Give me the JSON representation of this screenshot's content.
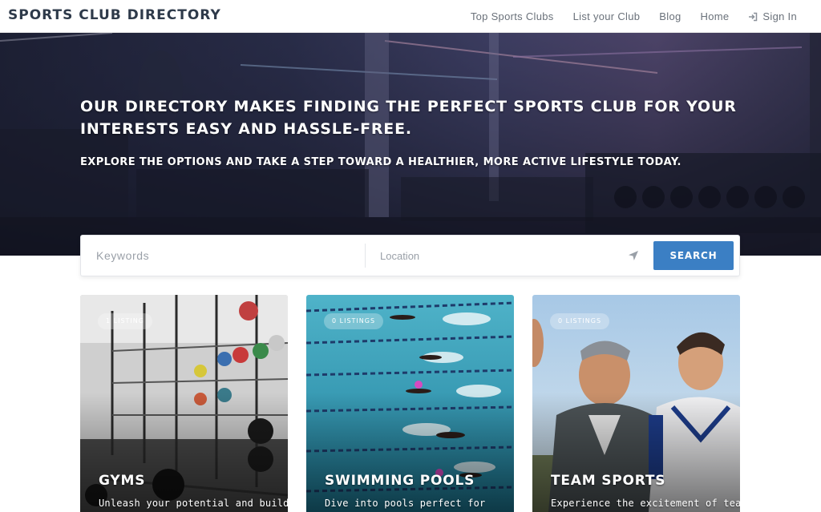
{
  "header": {
    "logo": "SPORTS CLUB DIRECTORY",
    "nav": [
      {
        "label": "Top Sports Clubs"
      },
      {
        "label": "List your Club"
      },
      {
        "label": "Blog"
      },
      {
        "label": "Home"
      }
    ],
    "signin_label": "Sign In",
    "signin_icon": "sign-in-icon"
  },
  "hero": {
    "title": "OUR DIRECTORY MAKES FINDING THE PERFECT SPORTS CLUB FOR YOUR INTERESTS EASY AND HASSLE-FREE.",
    "subtitle": "EXPLORE THE OPTIONS AND TAKE A STEP TOWARD A HEALTHIER, MORE ACTIVE LIFESTYLE TODAY."
  },
  "search": {
    "keywords_placeholder": "Keywords",
    "keywords_value": "",
    "location_placeholder": "Location",
    "location_value": "",
    "locate_icon": "location-arrow-icon",
    "button_label": "SEARCH",
    "button_color": "#3b7fc4"
  },
  "cards": [
    {
      "badge": "1 LISTING",
      "title": "GYMS",
      "desc": "Unleash your potential and build"
    },
    {
      "badge": "0 LISTINGS",
      "title": "SWIMMING POOLS",
      "desc": "Dive into pools perfect for"
    },
    {
      "badge": "0 LISTINGS",
      "title": "TEAM SPORTS",
      "desc": "Experience the excitement of team"
    }
  ]
}
